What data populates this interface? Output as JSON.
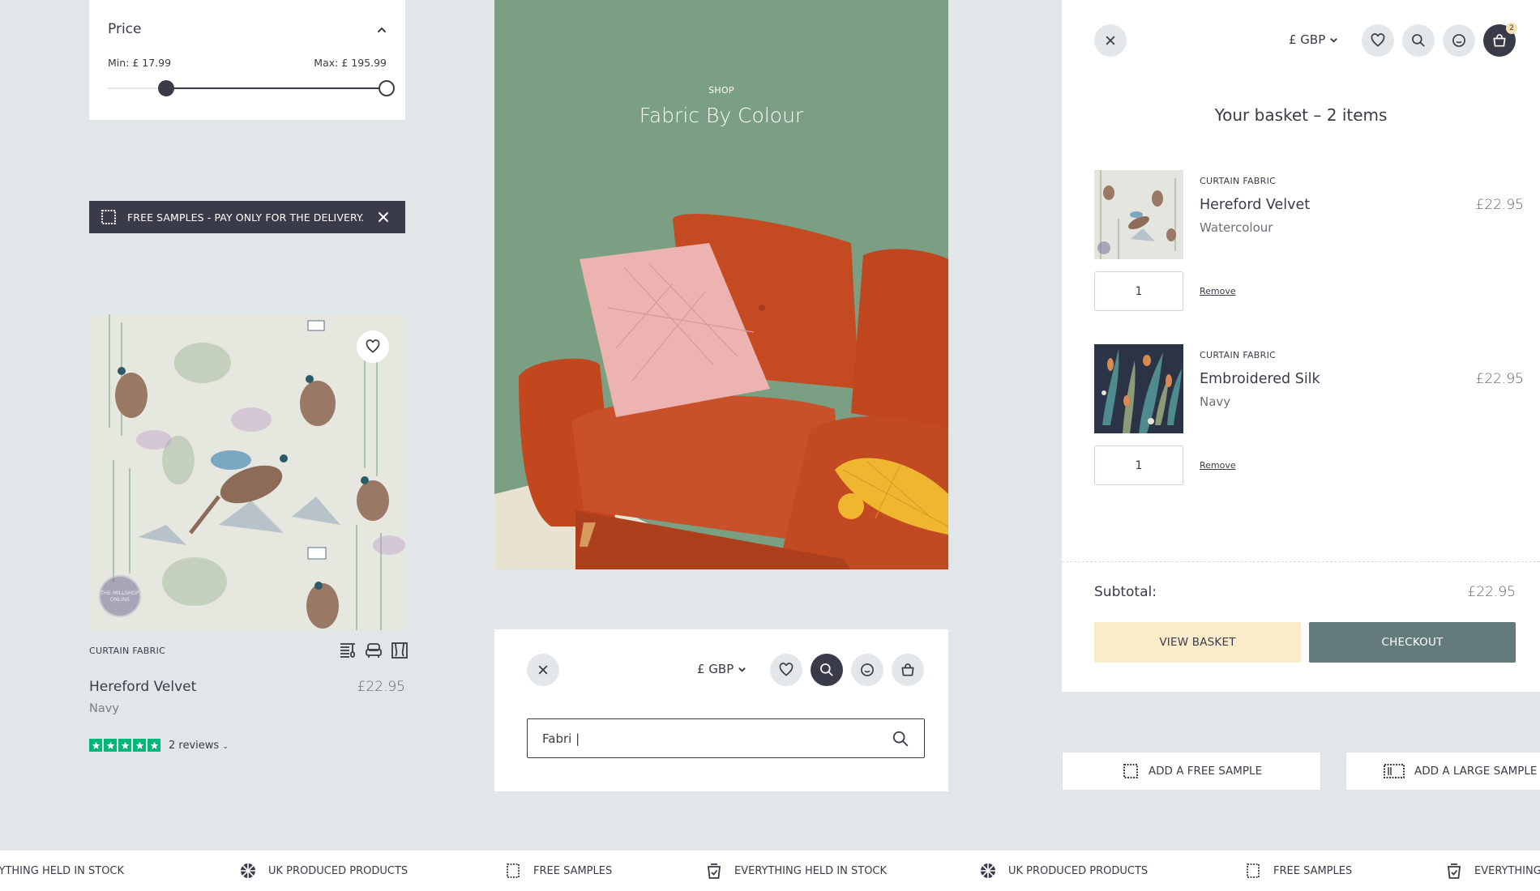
{
  "price_filter": {
    "title": "Price",
    "min_label": "Min: £ 17.99",
    "max_label": "Max: £ 195.99",
    "range_min": 17.99,
    "range_max": 195.99,
    "selected_min_fraction": 0.21,
    "selected_max_fraction": 1.0
  },
  "banner": {
    "text": "FREE SAMPLES - PAY ONLY FOR THE DELIVERY."
  },
  "product_card": {
    "category": "CURTAIN FABRIC",
    "name": "Hereford Velvet",
    "colour": "Navy",
    "price": "£22.95",
    "rating_stars": 5,
    "reviews_label": "2 reviews",
    "watermark": "THE MILLSHOP ONLINE",
    "use_icons": [
      "blind-icon",
      "armchair-icon",
      "curtain-icon"
    ]
  },
  "hero": {
    "eyebrow": "SHOP",
    "title": "Fabric By Colour"
  },
  "search_panel": {
    "currency": "£ GBP",
    "search_value": "Fabri |",
    "search_placeholder": "Search"
  },
  "basket": {
    "currency": "£ GBP",
    "cart_count": "2",
    "title": "Your basket – 2 items",
    "items": [
      {
        "category": "CURTAIN FABRIC",
        "name": "Hereford Velvet",
        "colour": "Watercolour",
        "price": "£22.95",
        "quantity": "1",
        "remove_label": "Remove"
      },
      {
        "category": "CURTAIN FABRIC",
        "name": "Embroidered Silk",
        "colour": "Navy",
        "price": "£22.95",
        "quantity": "1",
        "remove_label": "Remove"
      }
    ],
    "subtotal_label": "Subtotal:",
    "subtotal_value": "£22.95",
    "view_basket_label": "VIEW BASKET",
    "checkout_label": "CHECKOUT"
  },
  "sample_buttons": {
    "free": "ADD A FREE SAMPLE",
    "large": "ADD A LARGE SAMPLE -"
  },
  "usp_strip": [
    "EVERYTHING HELD IN STOCK",
    "UK PRODUCED PRODUCTS",
    "FREE SAMPLES",
    "EVERYTHING HELD IN STOCK",
    "UK PRODUCED PRODUCTS",
    "FREE SAMPLES",
    "EVERYTHING HELD IN STOCK"
  ],
  "colors": {
    "background": "#e1e6e9",
    "dark": "#393c48",
    "hero_green": "#7a9f83",
    "view_basket": "#faebcb",
    "checkout": "#637b7b",
    "trustpilot_green": "#00b67a",
    "badge": "#f6e2b3"
  }
}
